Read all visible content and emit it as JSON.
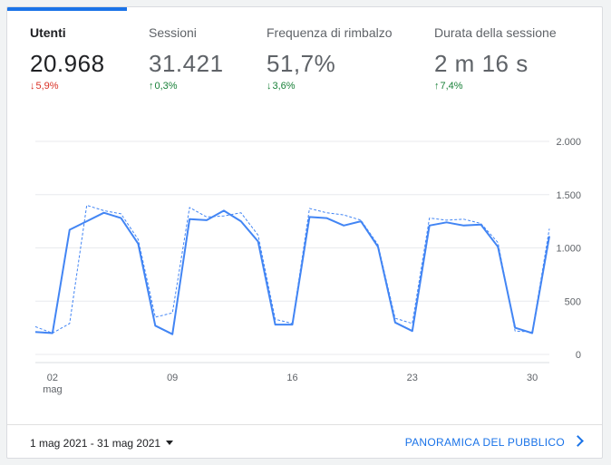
{
  "metrics": [
    {
      "label": "Utenti",
      "value": "20.968",
      "change": "5,9%",
      "direction": "down",
      "color": "#d93025",
      "active": true
    },
    {
      "label": "Sessioni",
      "value": "31.421",
      "change": "0,3%",
      "direction": "up",
      "color": "#188038",
      "active": false
    },
    {
      "label": "Frequenza di rimbalzo",
      "value": "51,7%",
      "change": "3,6%",
      "direction": "down",
      "color": "#188038",
      "active": false
    },
    {
      "label": "Durata della sessione",
      "value": "2 m 16 s",
      "change": "7,4%",
      "direction": "up",
      "color": "#188038",
      "active": false
    }
  ],
  "chart_data": {
    "type": "line",
    "x": [
      "1 mag",
      "2 mag",
      "3 mag",
      "4 mag",
      "5 mag",
      "6 mag",
      "7 mag",
      "8 mag",
      "9 mag",
      "10 mag",
      "11 mag",
      "12 mag",
      "13 mag",
      "14 mag",
      "15 mag",
      "16 mag",
      "17 mag",
      "18 mag",
      "19 mag",
      "20 mag",
      "21 mag",
      "22 mag",
      "23 mag",
      "24 mag",
      "25 mag",
      "26 mag",
      "27 mag",
      "28 mag",
      "29 mag",
      "30 mag",
      "31 mag"
    ],
    "x_tick_labels": [
      {
        "label": "02",
        "sublabel": "mag",
        "index": 1
      },
      {
        "label": "09",
        "sublabel": "",
        "index": 8
      },
      {
        "label": "16",
        "sublabel": "",
        "index": 15
      },
      {
        "label": "23",
        "sublabel": "",
        "index": 22
      },
      {
        "label": "30",
        "sublabel": "",
        "index": 29
      }
    ],
    "series": [
      {
        "style": "solid",
        "color": "#4285f4",
        "values": [
          210,
          200,
          1170,
          1250,
          1330,
          1280,
          1040,
          270,
          190,
          1270,
          1260,
          1350,
          1250,
          1060,
          280,
          280,
          1290,
          1280,
          1210,
          1250,
          1010,
          300,
          220,
          1210,
          1240,
          1210,
          1220,
          1010,
          250,
          200,
          1110
        ]
      },
      {
        "style": "dashed",
        "color": "#4285f4",
        "values": [
          260,
          200,
          290,
          1400,
          1350,
          1320,
          1080,
          350,
          390,
          1380,
          1290,
          1300,
          1330,
          1120,
          330,
          290,
          1370,
          1330,
          1310,
          1260,
          1030,
          340,
          290,
          1280,
          1260,
          1270,
          1230,
          1050,
          220,
          210,
          1180
        ]
      }
    ],
    "yticks": [
      "2.000",
      "1.500",
      "1.000",
      "500",
      "0"
    ],
    "ytick_values": [
      2000,
      1500,
      1000,
      500,
      0
    ],
    "ylim": [
      0,
      2000
    ],
    "grid": true
  },
  "footer": {
    "date_range": "1 mag 2021 - 31 mag 2021",
    "overview_link": "PANORAMICA DEL PUBBLICO"
  }
}
